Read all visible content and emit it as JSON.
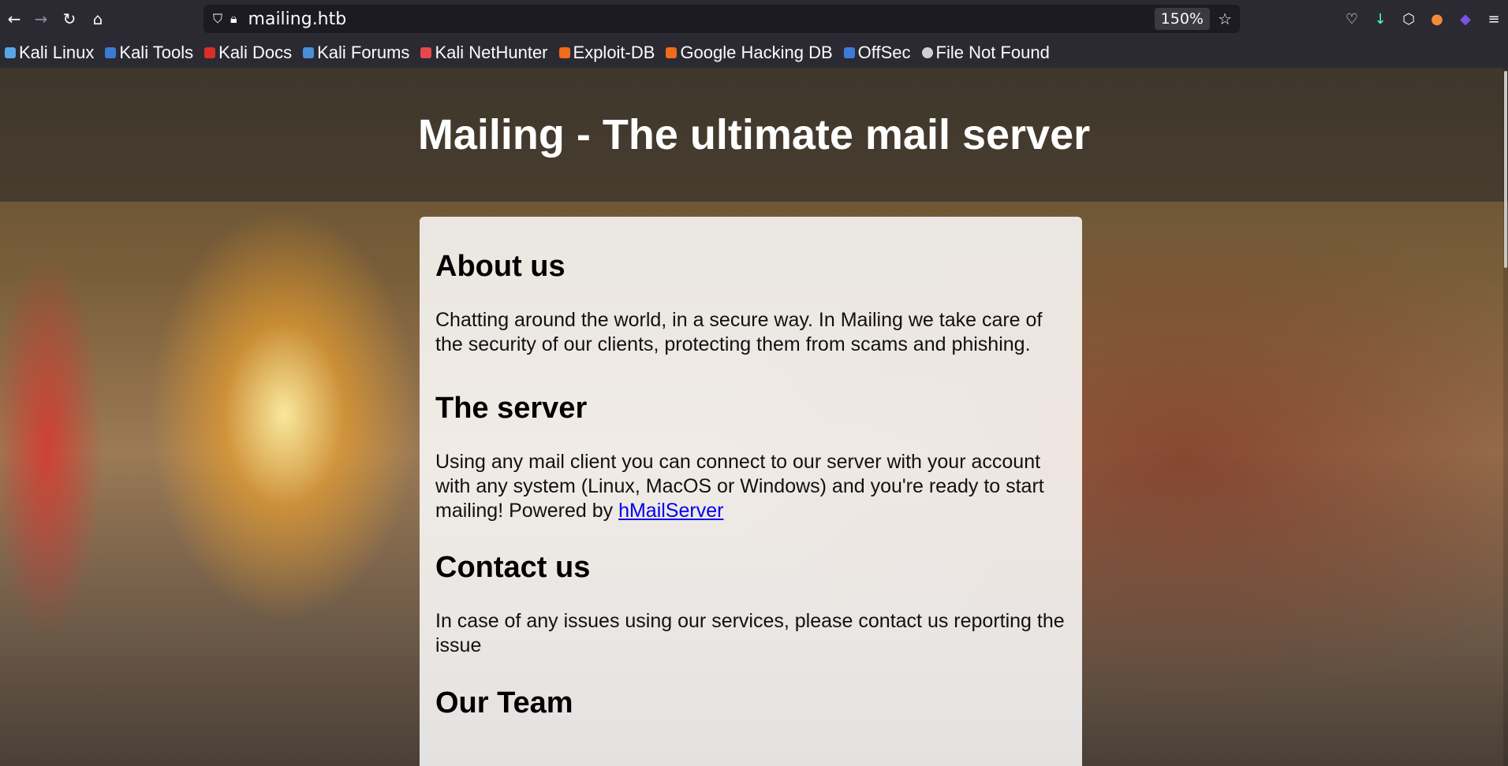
{
  "browser": {
    "url": "mailing.htb",
    "zoom": "150%",
    "bookmarks": [
      {
        "label": "Kali Linux",
        "color": "#5aa6e6"
      },
      {
        "label": "Kali Tools",
        "color": "#3a7bd5"
      },
      {
        "label": "Kali Docs",
        "color": "#d93025"
      },
      {
        "label": "Kali Forums",
        "color": "#4a90d9"
      },
      {
        "label": "Kali NetHunter",
        "color": "#e5484d"
      },
      {
        "label": "Exploit-DB",
        "color": "#f26b1d"
      },
      {
        "label": "Google Hacking DB",
        "color": "#f26b1d"
      },
      {
        "label": "OffSec",
        "color": "#3d7bd9"
      },
      {
        "label": "File Not Found",
        "color": "#cfcfd8"
      }
    ]
  },
  "page": {
    "title": "Mailing - The ultimate mail server",
    "about": {
      "heading": "About us",
      "text": "Chatting around the world, in a secure way. In Mailing we take care of the security of our clients, protecting them from scams and phishing."
    },
    "server": {
      "heading": "The server",
      "text": "Using any mail client you can connect to our server with your account with any system (Linux, MacOS or Windows) and you're ready to start mailing! Powered by ",
      "link": "hMailServer"
    },
    "contact": {
      "heading": "Contact us",
      "text": "In case of any issues using our services, please contact us reporting the issue"
    },
    "team": {
      "heading": "Our Team"
    }
  }
}
